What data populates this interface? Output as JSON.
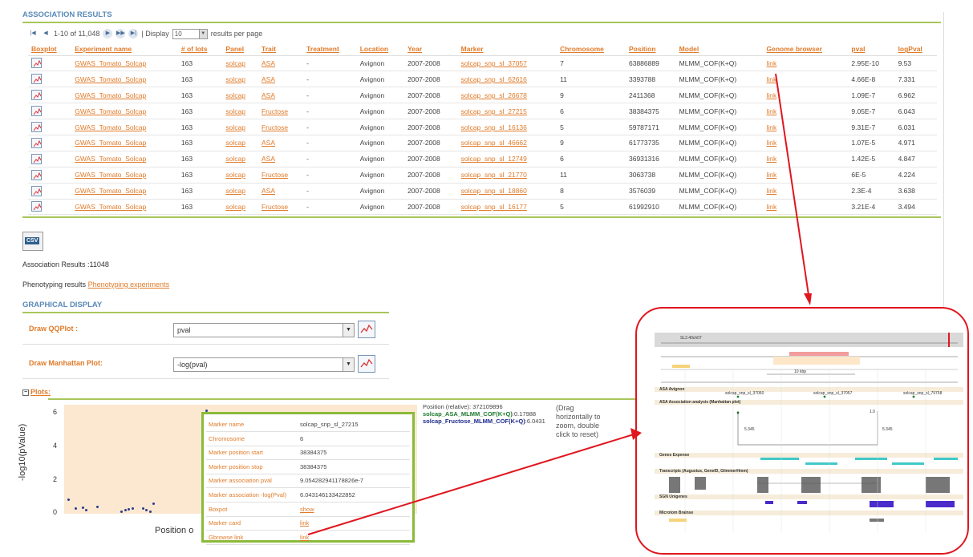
{
  "association": {
    "title": "ASSOCIATION RESULTS",
    "pager": {
      "range": "1-10 of 11,048",
      "display_label": "| Display",
      "page_size": "10",
      "per_page_label": "results per page"
    },
    "columns": [
      "Boxplot",
      "Experiment name",
      "# of lots",
      "Panel",
      "Trait",
      "Treatment",
      "Location",
      "Year",
      "Marker",
      "Chromosome",
      "Position",
      "Model",
      "Genome browser",
      "pval",
      "logPval"
    ],
    "rows": [
      {
        "experiment": "GWAS_Tomato_Solcap",
        "lots": "163",
        "panel": "solcap",
        "trait": "ASA",
        "treatment": "-",
        "location": "Avignon",
        "year": "2007-2008",
        "marker": "solcap_snp_sl_37057",
        "chromosome": "7",
        "position": "63886889",
        "model": "MLMM_COF(K+Q)",
        "browser": "link",
        "pval": "2.95E-10",
        "logpval": "9.53"
      },
      {
        "experiment": "GWAS_Tomato_Solcap",
        "lots": "163",
        "panel": "solcap",
        "trait": "ASA",
        "treatment": "-",
        "location": "Avignon",
        "year": "2007-2008",
        "marker": "solcap_snp_sl_62616",
        "chromosome": "11",
        "position": "3393788",
        "model": "MLMM_COF(K+Q)",
        "browser": "link",
        "pval": "4.66E-8",
        "logpval": "7.331"
      },
      {
        "experiment": "GWAS_Tomato_Solcap",
        "lots": "163",
        "panel": "solcap",
        "trait": "ASA",
        "treatment": "-",
        "location": "Avignon",
        "year": "2007-2008",
        "marker": "solcap_snp_sl_26678",
        "chromosome": "9",
        "position": "2411368",
        "model": "MLMM_COF(K+Q)",
        "browser": "link",
        "pval": "1.09E-7",
        "logpval": "6.962"
      },
      {
        "experiment": "GWAS_Tomato_Solcap",
        "lots": "163",
        "panel": "solcap",
        "trait": "Fructose",
        "treatment": "-",
        "location": "Avignon",
        "year": "2007-2008",
        "marker": "solcap_snp_sl_27215",
        "chromosome": "6",
        "position": "38384375",
        "model": "MLMM_COF(K+Q)",
        "browser": "link",
        "pval": "9.05E-7",
        "logpval": "6.043"
      },
      {
        "experiment": "GWAS_Tomato_Solcap",
        "lots": "163",
        "panel": "solcap",
        "trait": "Fructose",
        "treatment": "-",
        "location": "Avignon",
        "year": "2007-2008",
        "marker": "solcap_snp_sl_16136",
        "chromosome": "5",
        "position": "59787171",
        "model": "MLMM_COF(K+Q)",
        "browser": "link",
        "pval": "9.31E-7",
        "logpval": "6.031"
      },
      {
        "experiment": "GWAS_Tomato_Solcap",
        "lots": "163",
        "panel": "solcap",
        "trait": "ASA",
        "treatment": "-",
        "location": "Avignon",
        "year": "2007-2008",
        "marker": "solcap_snp_sl_46662",
        "chromosome": "9",
        "position": "61773735",
        "model": "MLMM_COF(K+Q)",
        "browser": "link",
        "pval": "1.07E-5",
        "logpval": "4.971"
      },
      {
        "experiment": "GWAS_Tomato_Solcap",
        "lots": "163",
        "panel": "solcap",
        "trait": "ASA",
        "treatment": "-",
        "location": "Avignon",
        "year": "2007-2008",
        "marker": "solcap_snp_sl_12749",
        "chromosome": "6",
        "position": "36931316",
        "model": "MLMM_COF(K+Q)",
        "browser": "link",
        "pval": "1.42E-5",
        "logpval": "4.847"
      },
      {
        "experiment": "GWAS_Tomato_Solcap",
        "lots": "163",
        "panel": "solcap",
        "trait": "Fructose",
        "treatment": "-",
        "location": "Avignon",
        "year": "2007-2008",
        "marker": "solcap_snp_sl_21770",
        "chromosome": "11",
        "position": "3063738",
        "model": "MLMM_COF(K+Q)",
        "browser": "link",
        "pval": "6E-5",
        "logpval": "4.224"
      },
      {
        "experiment": "GWAS_Tomato_Solcap",
        "lots": "163",
        "panel": "solcap",
        "trait": "ASA",
        "treatment": "-",
        "location": "Avignon",
        "year": "2007-2008",
        "marker": "solcap_snp_sl_18860",
        "chromosome": "8",
        "position": "3576039",
        "model": "MLMM_COF(K+Q)",
        "browser": "link",
        "pval": "2.3E-4",
        "logpval": "3.638"
      },
      {
        "experiment": "GWAS_Tomato_Solcap",
        "lots": "163",
        "panel": "solcap",
        "trait": "Fructose",
        "treatment": "-",
        "location": "Avignon",
        "year": "2007-2008",
        "marker": "solcap_snp_sl_16177",
        "chromosome": "5",
        "position": "61992910",
        "model": "MLMM_COF(K+Q)",
        "browser": "link",
        "pval": "3.21E-4",
        "logpval": "3.494"
      }
    ]
  },
  "csv_label": "CSV",
  "summary": {
    "count_text": "Association Results :11048",
    "phenotyping_label": "Phenotyping results",
    "phenotyping_link": "Phenotyping experiments"
  },
  "graphical": {
    "title": "GRAPHICAL DISPLAY",
    "qq_label": "Draw QQPlot :",
    "qq_value": "pval",
    "manhattan_label": "Draw Manhattan Plot:",
    "manhattan_value": "-log(pval)",
    "plots_label": "Plots:"
  },
  "plot": {
    "ylabel": "-log10(pValue)",
    "xlabel_visible": "Position o",
    "yticks": [
      "6",
      "4",
      "2",
      "0"
    ]
  },
  "chart_data": {
    "type": "scatter",
    "ylabel": "-log10(pValue)",
    "ylim": [
      0,
      6.5
    ],
    "series": [
      {
        "values": [
          0.7,
          0.2,
          0.1,
          0.0,
          0.1,
          0.15,
          0.2,
          0.1,
          0.0,
          0.5,
          0.25,
          0.3,
          0.2,
          6.04
        ]
      }
    ]
  },
  "tooltip": {
    "rows": [
      {
        "key": "Marker name",
        "value": "solcap_snp_sl_27215",
        "link": false
      },
      {
        "key": "Chromosome",
        "value": "6",
        "link": false
      },
      {
        "key": "Marker position start",
        "value": "38384375",
        "link": false
      },
      {
        "key": "Marker position stop",
        "value": "38384375",
        "link": false
      },
      {
        "key": "Marker association pval",
        "value": "9.054282941178826e-7",
        "link": false
      },
      {
        "key": "Marker association -log(Pval)",
        "value": "6.043146133422852",
        "link": false
      },
      {
        "key": "Boxpot",
        "value": "show",
        "link": true
      },
      {
        "key": "Marker card",
        "value": "link",
        "link": true
      },
      {
        "key": "Gbrowse link",
        "value": "link",
        "link": true
      }
    ]
  },
  "side_info": {
    "position": "Position (relative): 372109896",
    "series_a": "solcap_ASA_MLMM_COF(K+Q)",
    "series_a_value": ":0.17988",
    "series_b": "solcap_Fructose_MLMM_COF(K+Q)",
    "series_b_value": ":6.0431",
    "drag_hint": "(Drag horizontally to zoom, double click to reset)"
  },
  "genome_browser": {
    "chrom_label": "SL2.40ch07",
    "region_label": "10 kbp",
    "tracks": [
      "ASA Avignon",
      "ASA Association analysis (Manhattan plot)",
      "Genes Expense",
      "Transcripts (Augustus, GeneID, GlimmerHmm)",
      "SGN Unigenes",
      "Microtom Brainse"
    ],
    "markers": [
      "solcap_snp_sl_37050",
      "solcap_snp_sl_37057",
      "solcap_snp_sl_79758"
    ],
    "value_labels": [
      "5.345",
      "1.0"
    ]
  },
  "colors": {
    "accent_orange": "#e07b2a",
    "title_blue": "#5a8ab8",
    "green_rule": "#a8c65a",
    "callout_red": "#e0161e",
    "plot_bg": "#fce8d0"
  }
}
